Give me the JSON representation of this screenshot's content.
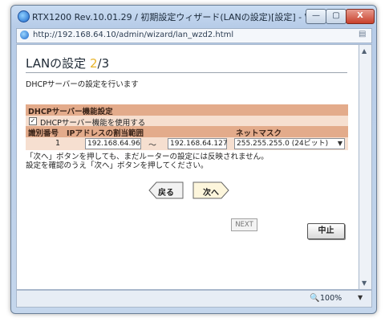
{
  "window": {
    "title": "RTX1200 Rev.10.01.29 / 初期設定ウィザード(LANの設定)[設定] - Windows In...",
    "controls": {
      "minimize": "—",
      "maximize": "▢",
      "close": "X"
    }
  },
  "address": {
    "url": "http://192.168.64.10/admin/wizard/lan_wzd2.html",
    "url_host": "192.168.64.10"
  },
  "page": {
    "title_main": "LANの設定",
    "title_step": "2",
    "title_total": "/3",
    "subtitle": "DHCPサーバーの設定を行います",
    "section_title": "DHCPサーバー機能設定",
    "checkbox_label": "DHCPサーバー機能を使用する",
    "checkbox_checked": true,
    "table": {
      "headers": [
        "識別番号",
        "IPアドレスの割当範囲",
        "ネットマスク"
      ],
      "rows": [
        {
          "id": "1",
          "start": "192.168.64.96",
          "end": "192.168.64.127",
          "mask": "255.255.255.0 (24ビット)"
        }
      ],
      "tilde": "〜"
    },
    "note_line1": "「次へ」ボタンを押しても、まだルーターの設定には反映されません。",
    "note_line2": "設定を確認のうえ「次へ」ボタンを押してください。",
    "back_label": "戻る",
    "next_label": "次へ",
    "next_small_label": "NEXT",
    "cancel_label": "中止"
  },
  "status": {
    "zoom": "100%"
  },
  "colors": {
    "section_bg": "#e3ab8b",
    "row_bg": "#f6dfd0",
    "step_color": "#e8b42a"
  }
}
